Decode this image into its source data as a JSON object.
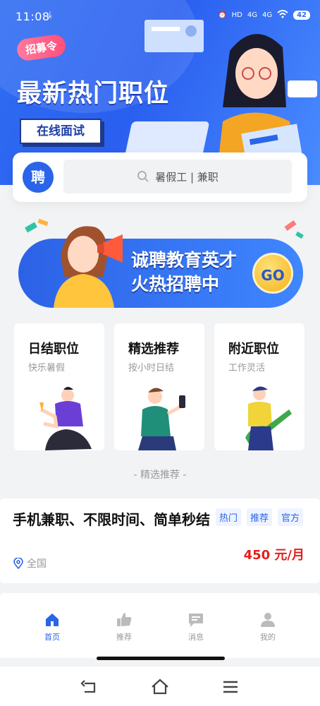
{
  "status_bar": {
    "time": "11:08",
    "download_glyph": "⤓",
    "hd_label": "HD",
    "network_1": "4G",
    "network_2": "4G",
    "battery": "42"
  },
  "hero": {
    "badge": "招募令",
    "title": "最新热门职位",
    "button": "在线面试"
  },
  "search": {
    "logo_text": "聘",
    "placeholder": "暑假工 | 兼职"
  },
  "banner": {
    "line1": "诚聘教育英才",
    "line2": "火热招聘中",
    "go": "GO"
  },
  "categories": [
    {
      "title": "日结职位",
      "subtitle": "快乐暑假",
      "icon": "person-drink-icon"
    },
    {
      "title": "精选推荐",
      "subtitle": "按小时日结",
      "icon": "person-phone-icon"
    },
    {
      "title": "附近职位",
      "subtitle": "工作灵活",
      "icon": "person-guitar-icon"
    }
  ],
  "section_title": "- 精选推荐 -",
  "job": {
    "title": "手机兼职、不限时间、简单秒结",
    "tags": [
      "热门",
      "推荐",
      "官方"
    ],
    "salary": "450 元/月",
    "location": "全国"
  },
  "tabbar": [
    {
      "label": "首页",
      "icon": "home-icon",
      "active": true
    },
    {
      "label": "推荐",
      "icon": "thumbs-up-icon",
      "active": false
    },
    {
      "label": "消息",
      "icon": "message-icon",
      "active": false
    },
    {
      "label": "我的",
      "icon": "user-icon",
      "active": false
    }
  ],
  "colors": {
    "primary": "#2a64e8",
    "salary": "#e2211c",
    "hero_bg": "#2f6df2"
  }
}
